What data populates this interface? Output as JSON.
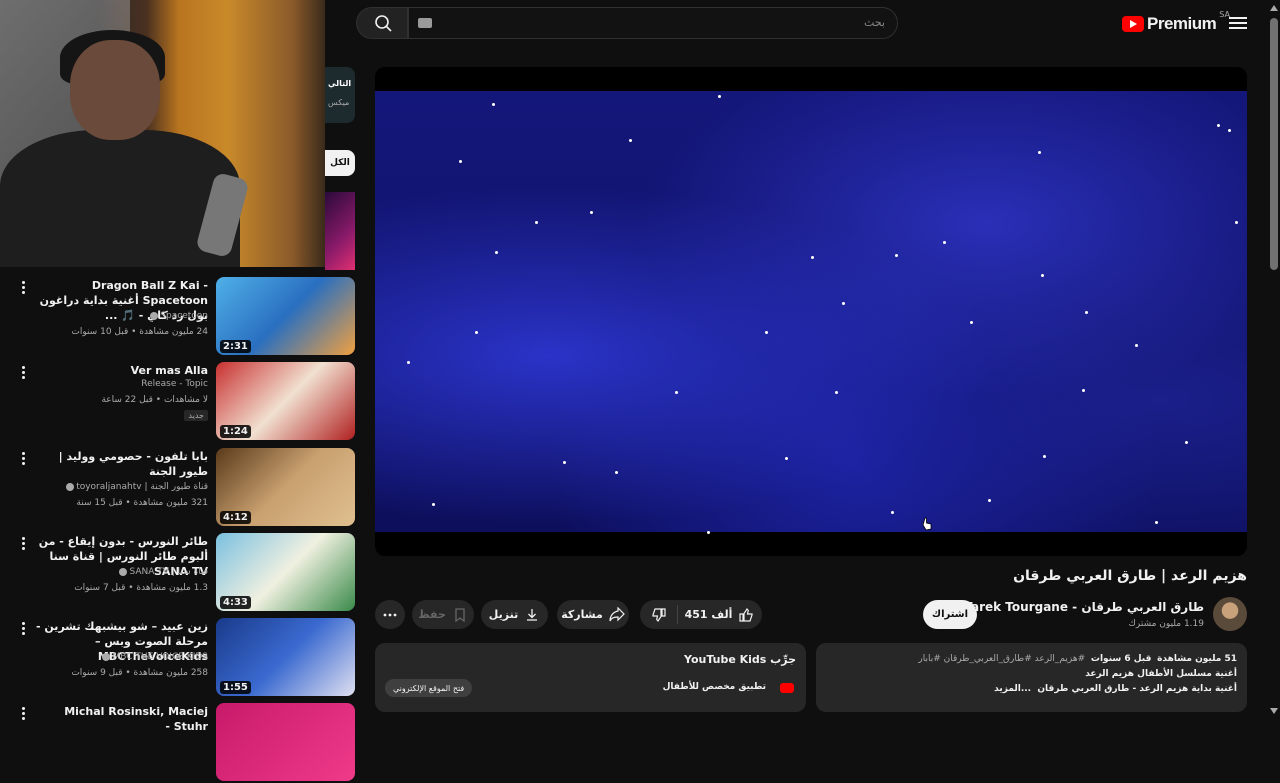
{
  "header": {
    "brand": "Premium",
    "region": "SA",
    "search_placeholder": "بحث"
  },
  "video": {
    "title": "هزيم الرعد | طارق العربي طرقان",
    "channel": "طارق العربي طرقان - Tarek Tourgane",
    "subscribers": "1.19 مليون مشترك",
    "subscribe_label": "اشتراك",
    "likes": "451 ألف",
    "share_label": "مشاركة",
    "download_label": "تنزيل",
    "save_label": "حفظ"
  },
  "description": {
    "views": "51 مليون مشاهدة",
    "age": "قبل 6 سنوات",
    "tags": "#هزيم_الرعد #طارق_العربي_طرقان #بابار",
    "line2": "أغنية مسلسل الأطفال هزيم الرعد",
    "line3": "أغنية بداية هزيم الرعد - طارق العربي طرقان",
    "more": "...المزيد"
  },
  "promo": {
    "heading": "جرِّب YouTube Kids",
    "subtitle": "تطبيق مخصص للأطفال",
    "button": "فتح الموقع الإلكتروني"
  },
  "side": {
    "peek_title": "التالي",
    "peek_sub": "ميكس",
    "chip": "الكل"
  },
  "list": [
    {
      "title": "Dragon Ball Z Kai - Spacetoon أغنية بداية دراغون بول زد كاي - 🎵 ...",
      "channel": "Spacetoon",
      "views": "24 مليون مشاهدة • قبل 10 سنوات",
      "duration": "2:31",
      "badge": ""
    },
    {
      "title": "Ver mas Alla",
      "channel": "Release - Topic",
      "views": "لا مشاهدات • قبل 22 ساعة",
      "duration": "1:24",
      "badge": "جديد"
    },
    {
      "title": "بابا تلفون - حصومي ووليد | طيور الجنة",
      "channel": "قناة طيور الجنة | toyoraljanahtv",
      "views": "321 مليون مشاهدة • قبل 15 سنة",
      "duration": "4:12",
      "badge": ""
    },
    {
      "title": "طائر النورس - بدون إيقاع - من ألبوم طائر النورس | قناة سنا SANA TV",
      "channel": "قناة سنا | SANA TV",
      "views": "1.3 مليون مشاهدة • قبل 7 سنوات",
      "duration": "4:33",
      "badge": ""
    },
    {
      "title": "زين عبيد – شو بيشبهك تشرين - مرحلة الصوت وبس – MBCTheVoiceKids",
      "channel": "MBC THE VOICE KIDS",
      "views": "258 مليون مشاهدة • قبل 9 سنوات",
      "duration": "1:55",
      "badge": ""
    },
    {
      "title": "Michal Rosinski, Maciej Stuhr -",
      "channel": "",
      "views": "",
      "duration": "",
      "badge": ""
    }
  ],
  "colors": {
    "background": "#0f0f0f",
    "surface": "#272727",
    "brand_red": "#ff0000",
    "text": "#f1f1f1",
    "muted": "#aaaaaa"
  },
  "icons": [
    "menu-icon",
    "youtube-logo-icon",
    "search-icon",
    "keyboard-icon",
    "like-icon",
    "dislike-icon",
    "share-icon",
    "download-icon",
    "save-icon",
    "more-icon",
    "verified-icon",
    "kebab-icon"
  ]
}
